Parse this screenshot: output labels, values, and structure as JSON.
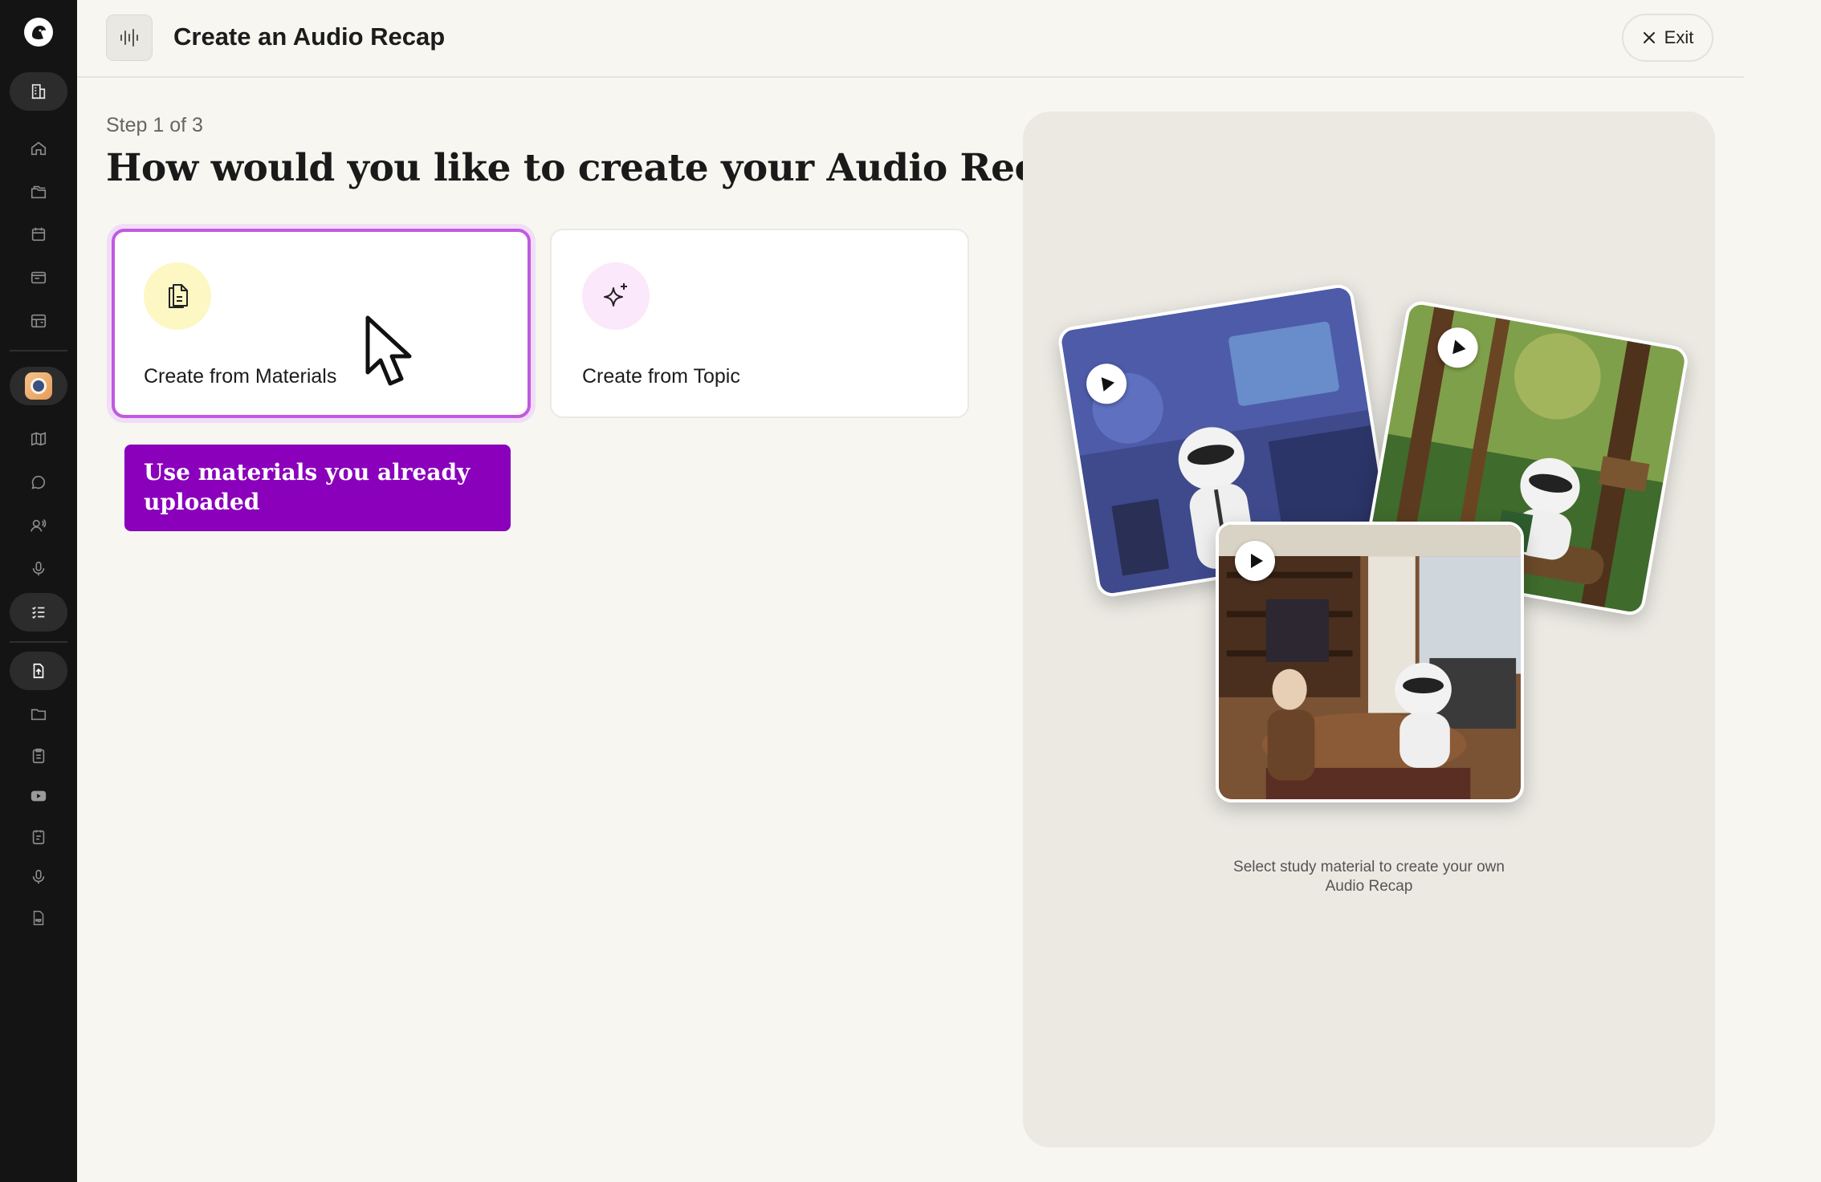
{
  "sidebar": {
    "items": [
      {
        "name": "home-icon"
      },
      {
        "name": "folders-icon"
      },
      {
        "name": "calendar-icon"
      },
      {
        "name": "window-icon"
      },
      {
        "name": "classroom-icon"
      },
      {
        "name": "active-app-icon"
      },
      {
        "name": "map-icon"
      },
      {
        "name": "chat-icon"
      },
      {
        "name": "tutor-icon"
      },
      {
        "name": "microphone-icon"
      },
      {
        "name": "checklist-icon"
      },
      {
        "name": "upload-file-icon"
      },
      {
        "name": "folder-icon"
      },
      {
        "name": "clipboard-icon"
      },
      {
        "name": "youtube-icon"
      },
      {
        "name": "notes-icon"
      },
      {
        "name": "microphone-small-icon"
      },
      {
        "name": "pdf-icon"
      }
    ]
  },
  "header": {
    "title": "Create an Audio Recap",
    "exit_label": "Exit"
  },
  "main": {
    "step": "Step 1 of 3",
    "headline": "How would you like to create your Audio Recap?",
    "options": [
      {
        "label": "Create from Materials",
        "icon": "documents-icon",
        "icon_bg": "#fdf7c4",
        "selected": true
      },
      {
        "label": "Create from Topic",
        "icon": "sparkle-icon",
        "icon_bg": "#fbe8fa",
        "selected": false
      }
    ],
    "tooltip": "Use materials you already uploaded"
  },
  "preview": {
    "caption_line1": "Select study material to create your own",
    "caption_line2": "Audio Recap"
  },
  "colors": {
    "accent": "#8a00bb",
    "selected_border": "#c05ae0",
    "background": "#f7f6f0",
    "sidebar": "#141414"
  }
}
